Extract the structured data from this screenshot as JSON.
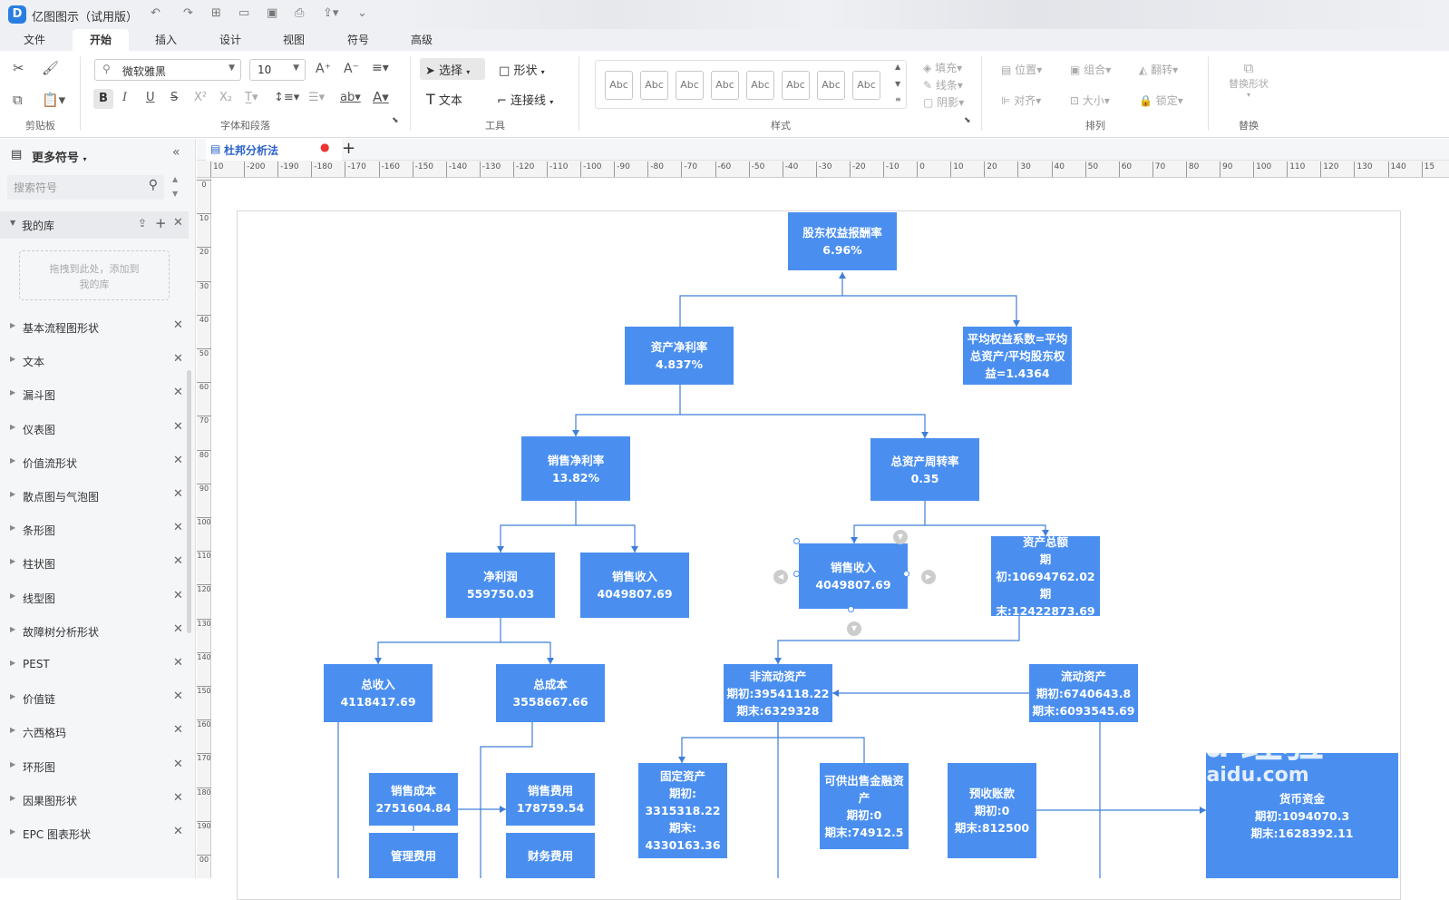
{
  "app": {
    "title": "亿图图示（试用版）",
    "logo": "D"
  },
  "menu": [
    "文件",
    "开始",
    "插入",
    "设计",
    "视图",
    "符号",
    "高级"
  ],
  "ribbon": {
    "font_name": "微软雅黑",
    "font_size": "10",
    "select_label": "选择",
    "shape_label": "形状",
    "text_label": "文本",
    "connector_label": "连接线",
    "style_sample": "Abc",
    "fill": "填充",
    "line": "线条",
    "shadow": "阴影",
    "position": "位置",
    "group": "组合",
    "flip": "翻转",
    "align": "对齐",
    "size": "大小",
    "lock": "锁定",
    "replace_shape": "替换形状",
    "groups": {
      "clipboard": "剪贴板",
      "font": "字体和段落",
      "tools": "工具",
      "style": "样式",
      "arrange": "排列",
      "replace": "替换"
    }
  },
  "sidebar": {
    "title": "更多符号",
    "search_placeholder": "搜索符号",
    "my_library": "我的库",
    "drop_hint": "拖拽到此处，添加到我的库",
    "libraries": [
      "基本流程图形状",
      "文本",
      "漏斗图",
      "仪表图",
      "价值流形状",
      "散点图与气泡图",
      "条形图",
      "柱状图",
      "线型图",
      "故障树分析形状",
      "PEST",
      "价值链",
      "六西格玛",
      "环形图",
      "因果图形状",
      "EPC 图表形状"
    ]
  },
  "document": {
    "tab_title": "杜邦分析法"
  },
  "ruler": {
    "h": [
      "10",
      "-200",
      "-190",
      "-180",
      "-170",
      "-160",
      "-150",
      "-140",
      "-130",
      "-120",
      "-110",
      "-100",
      "-90",
      "-80",
      "-70",
      "-60",
      "-50",
      "-40",
      "-30",
      "-20",
      "-10",
      "0",
      "10",
      "20",
      "30",
      "40",
      "50",
      "60",
      "70",
      "80",
      "90",
      "100",
      "110",
      "120",
      "130",
      "140",
      "15"
    ],
    "v": [
      "0",
      "10",
      "20",
      "30",
      "40",
      "50",
      "60",
      "70",
      "80",
      "90",
      "100",
      "110",
      "120",
      "130",
      "140",
      "150",
      "160",
      "170",
      "180",
      "190",
      "00"
    ]
  },
  "diagram": {
    "roe": {
      "label": "股东权益报酬率",
      "value": "6.96%"
    },
    "roa": {
      "label": "资产净利率",
      "value": "4.837%"
    },
    "equity_multiplier": "平均权益系数=平均总资产/平均股东权益=1.4364",
    "net_margin": {
      "label": "销售净利率",
      "value": "13.82%"
    },
    "asset_turnover": {
      "label": "总资产周转率",
      "value": "0.35"
    },
    "net_profit": {
      "label": "净利润",
      "value": "559750.03"
    },
    "sales_a": {
      "label": "销售收入",
      "value": "4049807.69"
    },
    "sales_b": {
      "label": "销售收入",
      "value": "4049807.69"
    },
    "total_assets": {
      "label": "资产总额",
      "begin": "期初:10694762.02",
      "end": "期末:12422873.69"
    },
    "total_revenue": {
      "label": "总收入",
      "value": "4118417.69"
    },
    "total_cost": {
      "label": "总成本",
      "value": "3558667.66"
    },
    "noncurrent": {
      "label": "非流动资产",
      "begin": "期初:3954118.22",
      "end": "期末:6329328"
    },
    "current": {
      "label": "流动资产",
      "begin": "期初:6740643.8",
      "end": "期末:6093545.69"
    },
    "cogs": {
      "label": "销售成本",
      "value": "2751604.84"
    },
    "selling_exp": {
      "label": "销售费用",
      "value": "178759.54"
    },
    "mgmt_exp": {
      "label": "管理费用"
    },
    "fin_exp": {
      "label": "财务费用"
    },
    "fixed_assets": {
      "label": "固定资产",
      "begin_label": "期初:",
      "begin": "3315318.22",
      "end_label": "期末:",
      "end": "4330163.36"
    },
    "afs": {
      "label": "可供出售金融资产",
      "begin": "期初:0",
      "end": "期末:74912.5"
    },
    "prepaid": {
      "label": "预收账款",
      "begin": "期初:0",
      "end": "期末:812500"
    },
    "cash": {
      "label": "货币资金",
      "begin": "期初:1094070.3",
      "end": "期末:1628392.11"
    }
  },
  "watermark": {
    "brand": "Bai du 经验",
    "url": "jingyan.baidu.com"
  },
  "colors": {
    "node": "#4a8ff0",
    "connector": "#3f7fd8",
    "accent": "#2a7de1"
  }
}
